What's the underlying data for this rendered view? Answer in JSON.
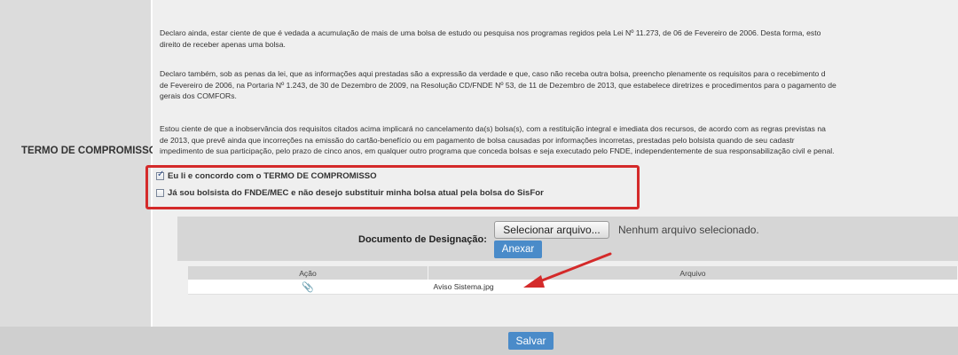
{
  "section": {
    "label": "TERMO DE COMPROMISSO"
  },
  "paragraphs": [
    "Declaro ainda, estar ciente de que é vedada a acumulação de mais de uma bolsa de estudo ou pesquisa nos programas regidos pela Lei Nº 11.273, de 06 de Fevereiro de 2006. Desta forma, esto",
    "direito de receber apenas uma bolsa.",
    "Declaro também, sob as penas da lei, que as informações aqui prestadas são a expressão da verdade e que, caso não receba outra bolsa, preencho plenamente os requisitos para o recebimento d",
    "de Fevereiro de 2006, na Portaria Nº 1.243, de 30 de Dezembro de 2009, na Resolução CD/FNDE Nº 53, de 11 de Dezembro de 2013, que estabelece diretrizes e procedimentos para o pagamento de",
    "gerais dos COMFORs.",
    "Estou ciente de que a inobservância dos requisitos citados acima implicará no cancelamento da(s) bolsa(s), com a restituição integral e imediata dos recursos, de acordo com as regras previstas na",
    "de 2013, que prevê ainda que incorreções na emissão do cartão-benefício ou em pagamento de bolsa causadas por informações incorretas, prestadas pelo bolsista quando de seu cadastr",
    "impedimento de sua participação, pelo prazo de cinco anos, em qualquer outro programa que conceda bolsas e seja executado pelo FNDE, independentemente de sua responsabilização civil e penal."
  ],
  "checkboxes": [
    {
      "label": "Eu li e concordo com o TERMO DE COMPROMISSO",
      "checked": true
    },
    {
      "label": "Já sou bolsista do FNDE/MEC e não desejo substituir minha bolsa atual pela bolsa do SisFor",
      "checked": false
    }
  ],
  "upload": {
    "label": "Documento de Designação:",
    "choose_button": "Selecionar arquivo...",
    "status": "Nenhum arquivo selecionado.",
    "attach_button": "Anexar"
  },
  "table": {
    "headers": [
      "Ação",
      "Arquivo"
    ],
    "rows": [
      {
        "action_icon": "paperclip-icon",
        "file": "Aviso Sistema.jpg"
      }
    ]
  },
  "footer": {
    "save_button": "Salvar"
  },
  "colors": {
    "highlight": "#d42a2a",
    "button_blue": "#4a8bc9"
  }
}
